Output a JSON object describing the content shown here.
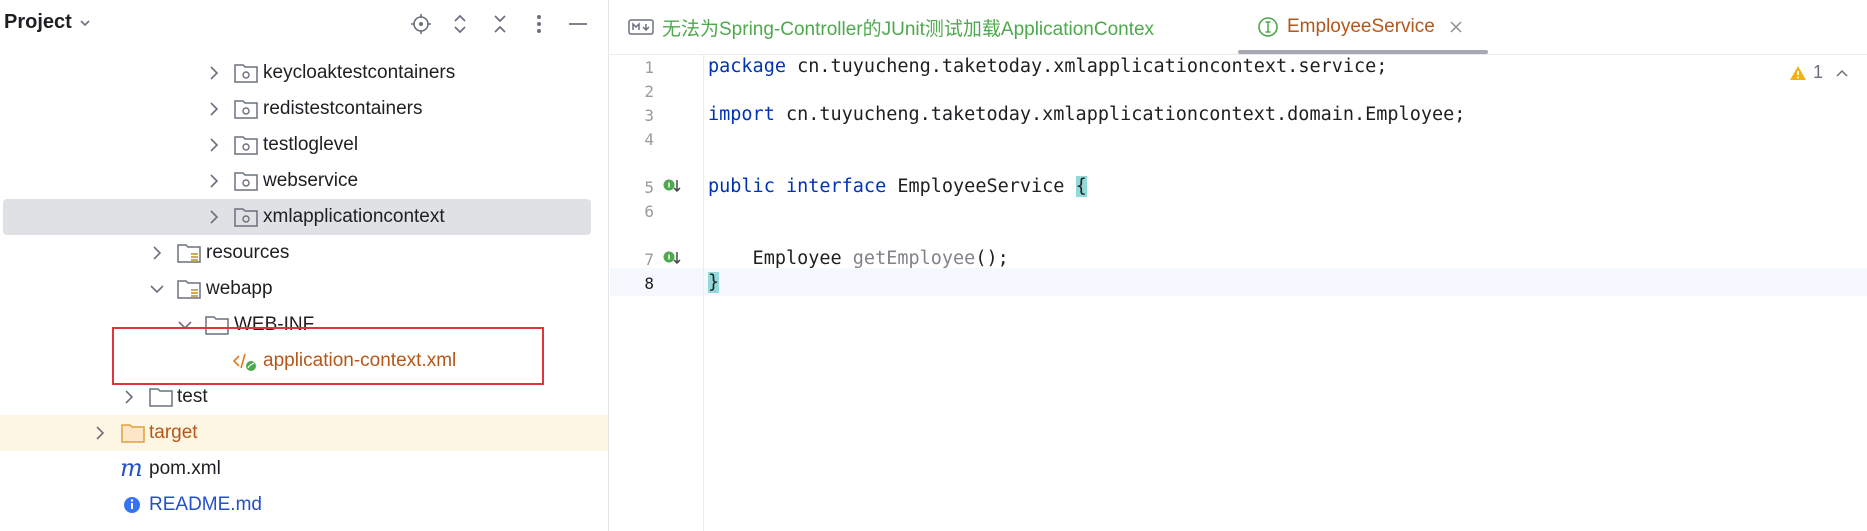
{
  "project_panel": {
    "title": "Project",
    "tree": [
      {
        "label": "keycloaktestcontainers"
      },
      {
        "label": "redistestcontainers"
      },
      {
        "label": "testloglevel"
      },
      {
        "label": "webservice"
      },
      {
        "label": "xmlapplicationcontext"
      },
      {
        "label": "resources"
      },
      {
        "label": "webapp"
      },
      {
        "label": "WEB-INF"
      },
      {
        "label": "application-context.xml"
      },
      {
        "label": "test"
      },
      {
        "label": "target"
      },
      {
        "label": "pom.xml"
      },
      {
        "label": "README.md"
      }
    ]
  },
  "editor": {
    "tabs": [
      {
        "label": "无法为Spring-Controller的JUnit测试加载ApplicationContex"
      },
      {
        "label": "EmployeeService"
      }
    ],
    "warnings_count": "1",
    "lines": [
      {
        "num": "1",
        "parts": [
          {
            "t": "package",
            "c": "kw"
          },
          {
            "t": " cn.tuyucheng.taketoday.xmlapplicationcontext.service;",
            "c": ""
          }
        ]
      },
      {
        "num": "2",
        "parts": []
      },
      {
        "num": "3",
        "parts": [
          {
            "t": "import",
            "c": "kw"
          },
          {
            "t": " cn.tuyucheng.taketoday.xmlapplicationcontext.domain.Employee;",
            "c": ""
          }
        ]
      },
      {
        "num": "4",
        "parts": []
      },
      {
        "num": "5",
        "parts": [
          {
            "t": "public",
            "c": "kw"
          },
          {
            "t": " ",
            "c": ""
          },
          {
            "t": "interface",
            "c": "kw"
          },
          {
            "t": " EmployeeService ",
            "c": ""
          },
          {
            "t": "{",
            "c": "brace-hl"
          }
        ]
      },
      {
        "num": "6",
        "parts": []
      },
      {
        "num": "7",
        "parts": [
          {
            "t": "    Employee ",
            "c": ""
          },
          {
            "t": "getEmployee",
            "c": "fn-gray"
          },
          {
            "t": "();",
            "c": ""
          }
        ]
      },
      {
        "num": "8",
        "parts": [
          {
            "t": "}",
            "c": "brace-hl"
          }
        ]
      }
    ]
  },
  "colors": {
    "accent_orange": "#b4571a",
    "link_blue": "#2451c5",
    "keyword_blue": "#0033b3",
    "highlight_red": "#e0333a",
    "tab_green": "#4ea84d"
  }
}
